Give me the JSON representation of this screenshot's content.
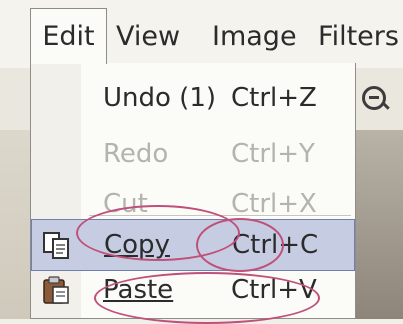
{
  "menubar": {
    "items": [
      {
        "label": "Edit",
        "mnemonic": "E"
      },
      {
        "label": "View",
        "mnemonic": "V"
      },
      {
        "label": "Image",
        "mnemonic": ""
      },
      {
        "label": "Filters",
        "mnemonic": ""
      }
    ]
  },
  "menu": {
    "items": [
      {
        "label": "Undo (1)",
        "shortcut": "Ctrl+Z",
        "enabled": true
      },
      {
        "label": "Redo",
        "shortcut": "Ctrl+Y",
        "enabled": false
      },
      {
        "label": "Cut",
        "shortcut": "Ctrl+X",
        "enabled": false
      },
      {
        "label": "Copy",
        "shortcut": "Ctrl+C",
        "enabled": true,
        "highlighted": true,
        "icon": "copy-icon"
      },
      {
        "label": "Paste",
        "shortcut": "Ctrl+V",
        "enabled": true,
        "icon": "paste-icon"
      }
    ]
  },
  "colors": {
    "highlight": "#c6cde3",
    "annotation": "#c0507a"
  }
}
